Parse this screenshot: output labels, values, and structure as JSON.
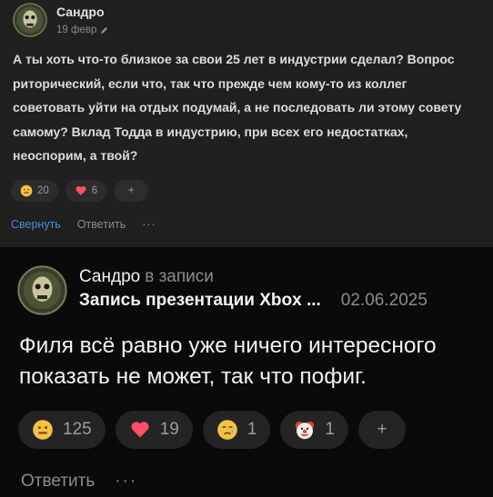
{
  "top_comment": {
    "author": "Сандро",
    "date": "19 февр",
    "text": "А ты хоть что-то близкое за свои 25 лет в индустрии сделал? Вопрос риторический, если что, так что прежде чем кому-то из коллег советовать уйти на отдых подумай, а не последовать ли этому совету самому? Вклад Тодда в индустрию, при всех его недостатках, неоспорим, а твой?",
    "reactions": [
      {
        "icon": "smile-emoji-icon",
        "count": "20"
      },
      {
        "icon": "heart-emoji-icon",
        "count": "6"
      }
    ],
    "add_label": "+",
    "actions": {
      "collapse": "Свернуть",
      "reply": "Ответить",
      "more": "···"
    }
  },
  "bottom_comment": {
    "author": "Сандро",
    "in_post_label": "в записи",
    "post_title": "Запись презентации Xbox ...",
    "date": "02.06.2025",
    "text": "Филя всё равно уже ничего интересного показать не может, так что пофиг.",
    "reactions": [
      {
        "icon": "smile-emoji-icon",
        "count": "125"
      },
      {
        "icon": "heart-emoji-icon",
        "count": "19"
      },
      {
        "icon": "crying-emoji-icon",
        "count": "1"
      },
      {
        "icon": "clown-emoji-icon",
        "count": "1"
      }
    ],
    "add_label": "+",
    "actions": {
      "reply": "Ответить",
      "more": "···"
    }
  },
  "colors": {
    "top_panel": "#202020",
    "bottom_panel": "#0a0a0a",
    "link_blue": "#4a8fd6",
    "pill_bg": "#242424"
  }
}
